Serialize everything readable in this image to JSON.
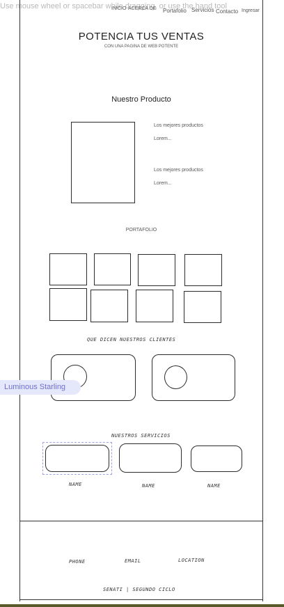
{
  "editor_hint": "Use mouse wheel or spacebar while dragging, or use the hand tool",
  "nav": {
    "inicio": "INICIO",
    "acerca": "ACERCA DE",
    "portafolio": "Portafolio",
    "servicios": "Servicios",
    "contacto": "Contacto",
    "ingresar": "Ingresar"
  },
  "hero": {
    "title": "POTENCIA TUS VENTAS",
    "subtitle": "CON UNA PAGINA DE WEB POTENTE"
  },
  "product": {
    "heading": "Nuestro Producto",
    "blocks": [
      {
        "title": "Los mejores productos",
        "body": "Lorem..."
      },
      {
        "title": "Los mejores productos",
        "body": "Lorem..."
      }
    ]
  },
  "portfolio": {
    "heading": "PORTAFOLIO"
  },
  "testimonials": {
    "heading": "QUE DICEN NUESTROS CLIENTES"
  },
  "services": {
    "heading": "NUESTROS SERVICIOS",
    "names": [
      "NAME",
      "NAME",
      "NAME"
    ]
  },
  "footer": {
    "phone": "PHONE",
    "email": "EMAIL",
    "location": "LOCATION",
    "credit": "SENATI | SEGUNDO CICLO"
  },
  "collaborator": {
    "name": "Luminous Starling"
  },
  "colors": {
    "selection": "#9fa3e0",
    "cursor_tag_bg": "#e5e7fb",
    "cursor_tag_text": "#6d71c9"
  }
}
